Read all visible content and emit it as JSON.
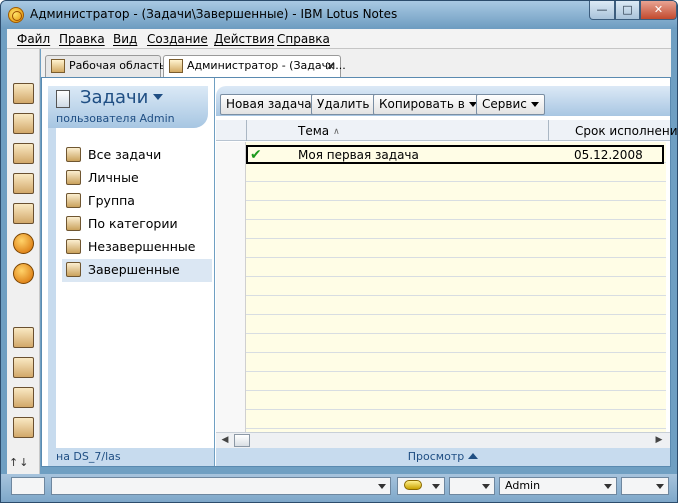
{
  "window": {
    "title": "Администратор - (Задачи\\Завершенные) - IBM Lotus Notes"
  },
  "menu": [
    "Файл",
    "Правка",
    "Вид",
    "Создание",
    "Действия",
    "Справка"
  ],
  "tabs": [
    {
      "label": "Рабочая область",
      "active": false
    },
    {
      "label": "Администратор - (Задачи...",
      "active": true
    }
  ],
  "navigator": {
    "title": "Задачи",
    "subtitle": "пользователя Admin",
    "views": [
      {
        "label": "Все задачи",
        "icon": "all-tasks-icon",
        "selected": false
      },
      {
        "label": "Личные",
        "icon": "person-icon",
        "selected": false
      },
      {
        "label": "Группа",
        "icon": "group-icon",
        "selected": false
      },
      {
        "label": "По категории",
        "icon": "category-icon",
        "selected": false
      },
      {
        "label": "Незавершенные",
        "icon": "incomplete-icon",
        "selected": false
      },
      {
        "label": "Завершенные",
        "icon": "completed-icon",
        "selected": true
      }
    ],
    "footer": "на DS_7/las"
  },
  "actions": {
    "new_task": "Новая задача",
    "delete": "Удалить",
    "copy_to": "Копировать в",
    "tools": "Сервис"
  },
  "columns": {
    "subject": "Тема",
    "due": "Срок исполнени"
  },
  "rows": [
    {
      "subject": "Моя первая задача",
      "due": "05.12.2008",
      "status_icon": "check-icon"
    }
  ],
  "view_footer": "Просмотр",
  "statusbar": {
    "user": "Admin"
  },
  "colors": {
    "frame_blue": "#6f9fc2",
    "header_blue": "#1f4e83",
    "grid_yellow": "#fffde6",
    "check_green": "#1d9a1d"
  }
}
